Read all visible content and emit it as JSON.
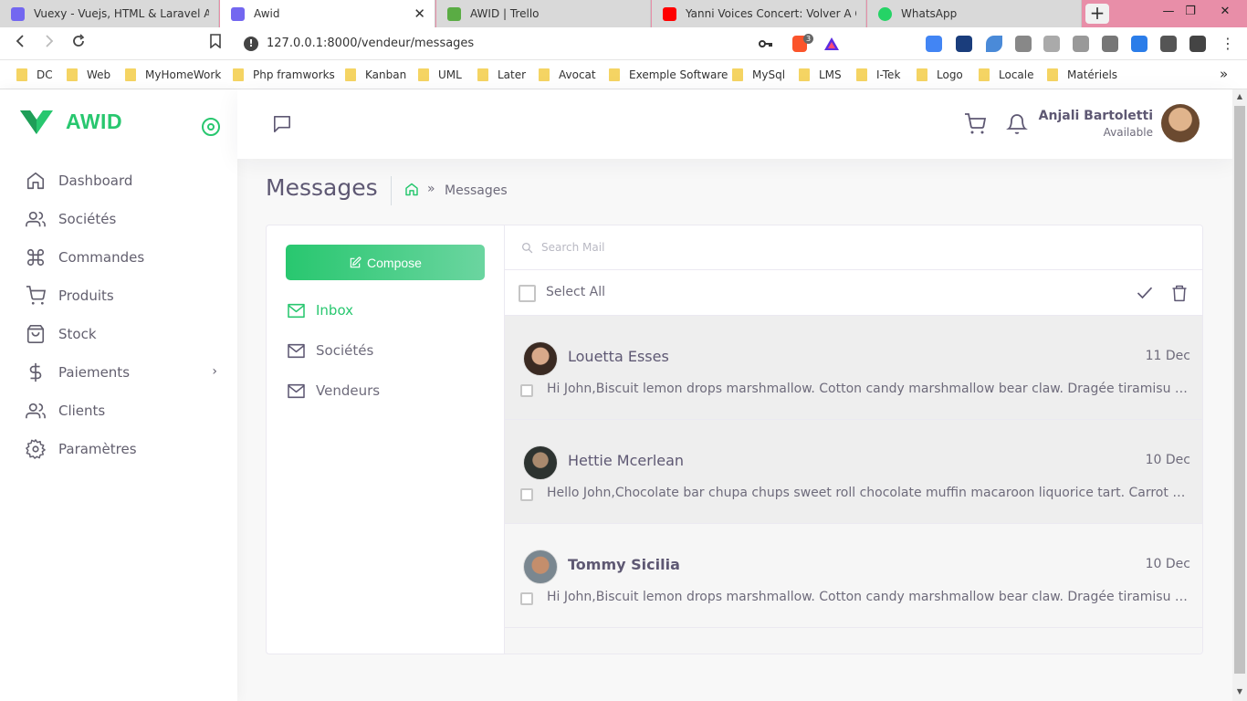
{
  "browser": {
    "tabs": [
      {
        "title": "Vuexy - Vuejs, HTML & Laravel Admin",
        "icon": "vuexy-icon",
        "color": "#7367f0"
      },
      {
        "title": "Awid",
        "icon": "vuexy-icon",
        "color": "#7367f0",
        "close": "✕"
      },
      {
        "title": "AWID | Trello",
        "icon": "trello-icon",
        "color": "#5aac44"
      },
      {
        "title": "Yanni Voices Concert: Volver A Cr",
        "icon": "youtube-icon",
        "color": "#ff0000"
      },
      {
        "title": "WhatsApp",
        "icon": "whatsapp-icon",
        "color": "#25d366"
      }
    ],
    "url": "127.0.0.1:8000/vendeur/messages",
    "bookmarks": [
      "DC",
      "Web",
      "MyHomeWork",
      "Php framworks",
      "Kanban",
      "UML",
      "Later",
      "Avocat",
      "Exemple Software",
      "MySql",
      "LMS",
      "I-Tek",
      "Logo",
      "Locale",
      "Matériels"
    ],
    "bookmarks_more": "»",
    "brave_badge": "3"
  },
  "sidebar": {
    "logo": "AWID",
    "brand_color": "#28c76f",
    "items": [
      {
        "label": "Dashboard",
        "icon": "home-icon"
      },
      {
        "label": "Sociétés",
        "icon": "users-icon"
      },
      {
        "label": "Commandes",
        "icon": "command-icon"
      },
      {
        "label": "Produits",
        "icon": "cart-icon"
      },
      {
        "label": "Stock",
        "icon": "bag-icon"
      },
      {
        "label": "Paiements",
        "icon": "dollar-icon",
        "chevron": "›"
      },
      {
        "label": "Clients",
        "icon": "users-icon"
      },
      {
        "label": "Paramètres",
        "icon": "settings-icon"
      }
    ]
  },
  "header": {
    "user_name": "Anjali Bartoletti",
    "user_status": "Available"
  },
  "page": {
    "title": "Messages",
    "breadcrumb_arrow": "»",
    "breadcrumb_current": "Messages"
  },
  "mail": {
    "compose_label": "Compose",
    "folders": [
      {
        "label": "Inbox",
        "active": true
      },
      {
        "label": "Sociétés",
        "active": false
      },
      {
        "label": "Vendeurs",
        "active": false
      }
    ],
    "search_placeholder": "Search Mail",
    "select_all_label": "Select All",
    "messages": [
      {
        "from": "Louetta Esses",
        "date": "11 Dec",
        "preview": "Hi John,Biscuit lemon drops marshmallow. Cotton candy marshmallow bear claw. Dragée tiramisu cookie cotton candy.",
        "read": true
      },
      {
        "from": "Hettie Mcerlean",
        "date": "10 Dec",
        "preview": "Hello John,Chocolate bar chupa chups sweet roll chocolate muffin macaroon liquorice tart. Carrot cake topping jelly.",
        "read": true
      },
      {
        "from": "Tommy Sicilia",
        "date": "10 Dec",
        "preview": "Hi John,Biscuit lemon drops marshmallow. Cotton candy marshmallow bear claw. Dragée tiramisu cookie cotton candy.",
        "read": false
      }
    ]
  }
}
